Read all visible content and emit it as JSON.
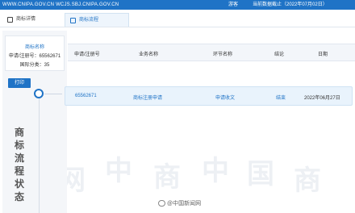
{
  "topbar": {
    "url": "WWW.CNIPA.GOV.CN WCJS.SBJ.CNIPA.GOV.CN",
    "user": "游客",
    "date": "当前数据截止（2022年07月02日）"
  },
  "tabs": [
    {
      "label": "商标详情"
    },
    {
      "label": "商标流程"
    }
  ],
  "info": {
    "trademark_label": "商标名称",
    "application_number": "申请/注册号：65562671",
    "class": "国际分类：35"
  },
  "print_label": "打印",
  "vertical_title": [
    "商",
    "标",
    "流",
    "程",
    "状",
    "态"
  ],
  "table": {
    "headers": [
      "申请/注册号",
      "业务名称",
      "环节名称",
      "结论",
      "日期"
    ],
    "rows": [
      {
        "number": "65562671",
        "business": "商标注册申请",
        "step": "申请收文",
        "result": "结束",
        "date": "2022年06月27日"
      }
    ]
  },
  "watermark_chars": [
    "中",
    "国",
    "商",
    "标",
    "网"
  ],
  "credit": "@中国新闻网"
}
